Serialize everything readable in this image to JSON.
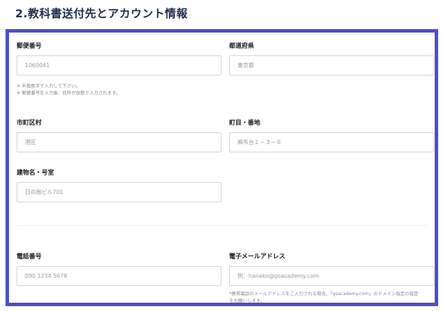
{
  "section": {
    "title": "2.教科書送付先とアカウント情報"
  },
  "form": {
    "postal_code": {
      "label": "郵便番号",
      "placeholder": "1060041",
      "notes": [
        "※ 半角数字で入力して下さい。",
        "※ 郵便番号を入力後、住所が自動で入力されます。"
      ]
    },
    "prefecture": {
      "label": "都道府県",
      "placeholder": "東京都"
    },
    "city": {
      "label": "市町区村",
      "placeholder": "港区"
    },
    "street": {
      "label": "町目・番地",
      "placeholder": "麻布台１－３－６"
    },
    "building": {
      "label": "建物名・号室",
      "placeholder": "日の樹ビル701"
    },
    "phone": {
      "label": "電話番号",
      "placeholder": "090 1234 5678"
    },
    "email": {
      "label": "電子メールアドレス",
      "placeholder": "例：hanako@gsacademy.com",
      "notes": [
        "*携帯電話のメールアドレスをご入力される場合、「gsacademy.com」のドメイン指定の設定",
        "をお願いします。"
      ]
    }
  },
  "colors": {
    "frame_border": "#4a4fc9",
    "title": "#1f2d4e"
  }
}
